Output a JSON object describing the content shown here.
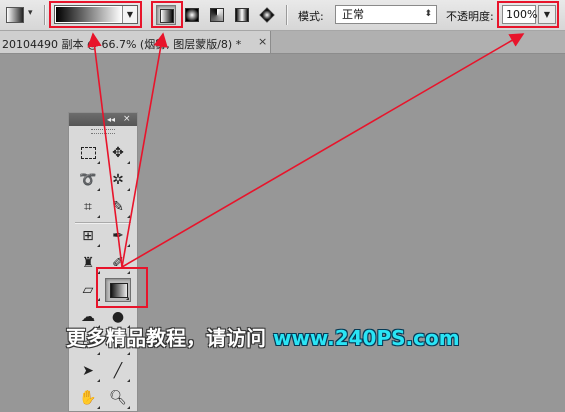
{
  "options_bar": {
    "mode_label": "模式:",
    "mode_value": "正常",
    "opacity_label": "不透明度:",
    "opacity_value": "100%",
    "gradient_types": [
      "linear",
      "radial",
      "angle",
      "reflected",
      "diamond"
    ],
    "active_gradient_type": "linear"
  },
  "document": {
    "tab_title": "20104490 副本 @ 66.7% (烟雾, 图层蒙版/8) *",
    "close_glyph": "×"
  },
  "tools_panel": {
    "collapse_glyph": "◂◂",
    "close_glyph": "×",
    "active_tool": "gradient-tool",
    "tools": [
      "rectangular-marquee",
      "move",
      "lasso",
      "magic-wand",
      "crop",
      "eyedropper",
      "spot-healing",
      "brush",
      "clone-stamp",
      "history-brush",
      "eraser",
      "gradient",
      "pen",
      "blur",
      "path-selection",
      "line",
      "hand",
      "zoom"
    ]
  },
  "caption": {
    "text": "更多精品教程，请访问 ",
    "site": "www.240PS.com"
  },
  "colors": {
    "annotation": "#e8142b",
    "canvas": "#979797",
    "caption_site": "#2ae4f5"
  }
}
